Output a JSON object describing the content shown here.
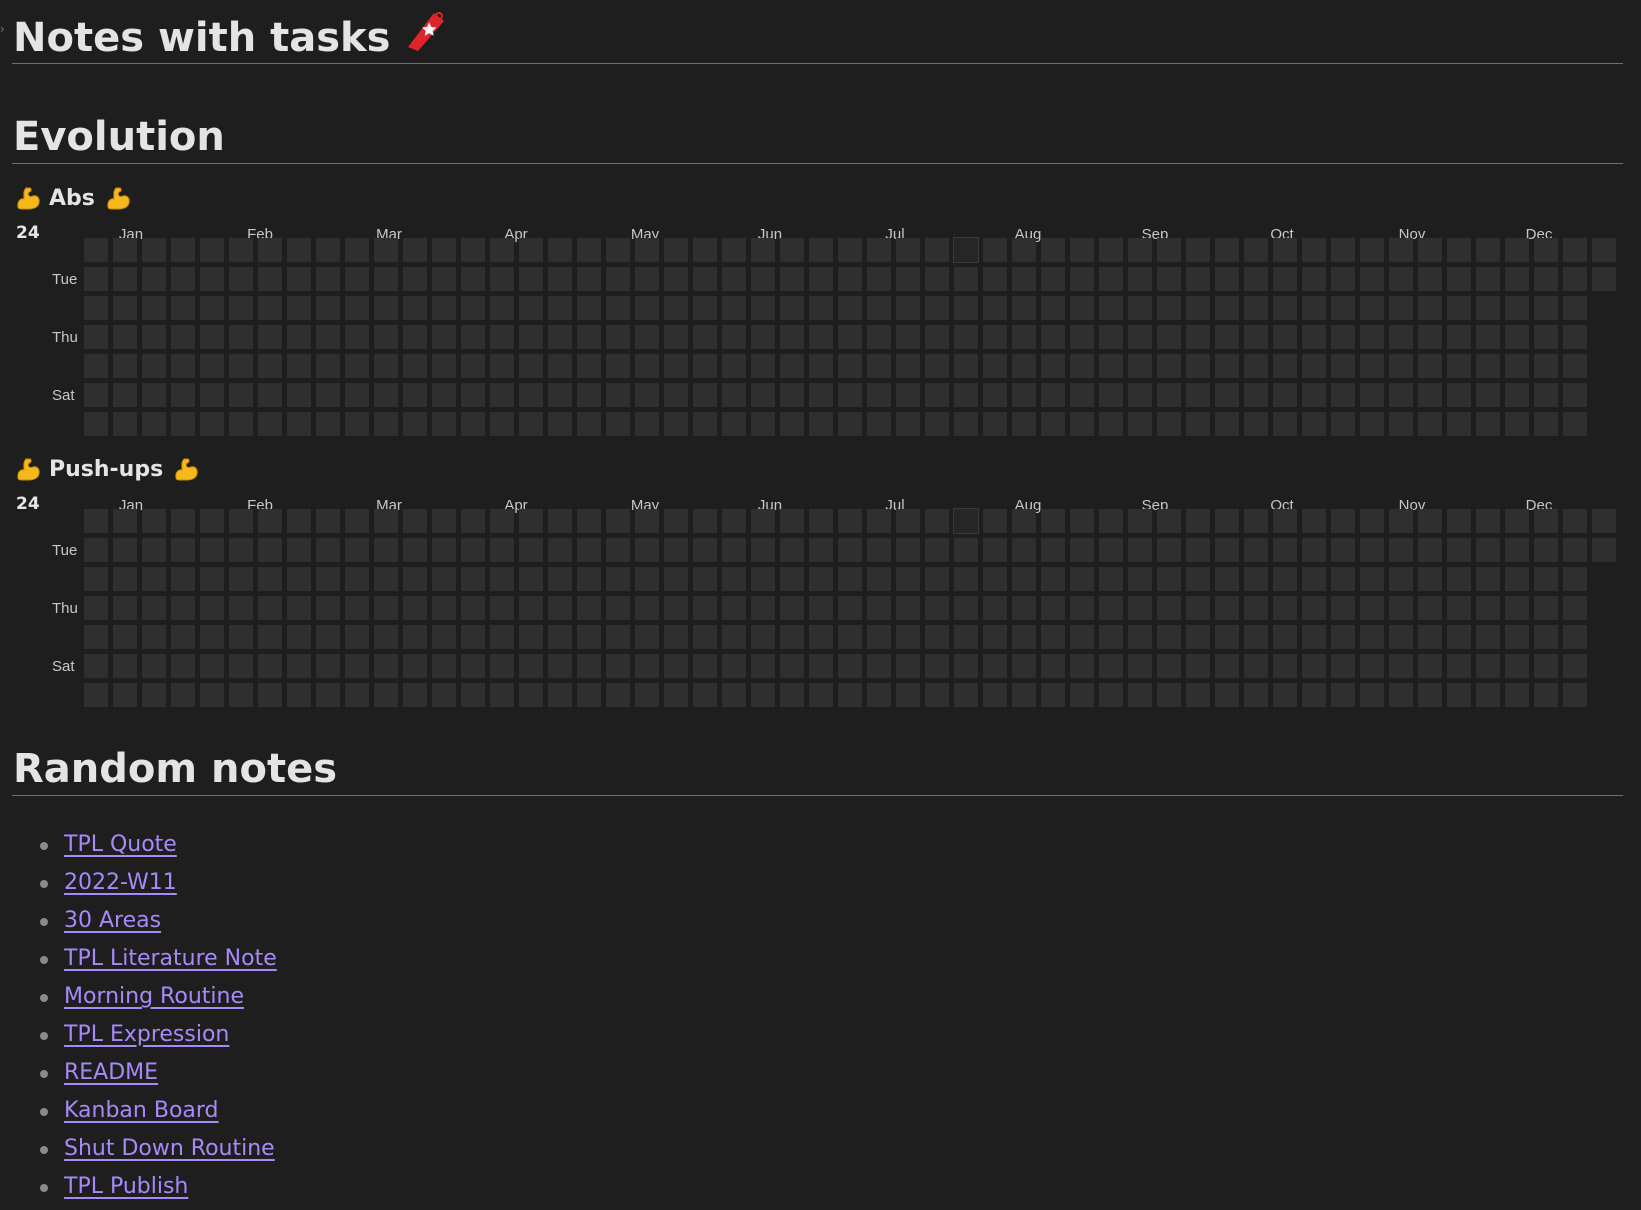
{
  "page": {
    "fold_caret": "›",
    "title": "Notes with tasks",
    "title_icon": "red-tag-icon"
  },
  "evolution": {
    "heading": "Evolution",
    "year": "24",
    "months": [
      "Jan",
      "Feb",
      "Mar",
      "Apr",
      "May",
      "Jun",
      "Jul",
      "Aug",
      "Sep",
      "Oct",
      "Nov",
      "Dec"
    ],
    "day_labels": [
      "Tue",
      "Thu",
      "Sat"
    ],
    "cell_color": "#2f2f2f",
    "trackers": [
      {
        "name": "Abs",
        "icon": "flexed-biceps-icon",
        "completed_days": 0
      },
      {
        "name": "Push-ups",
        "icon": "flexed-biceps-icon",
        "completed_days": 0
      }
    ]
  },
  "random_notes": {
    "heading": "Random notes",
    "link_color": "#a68af9",
    "items": [
      "TPL Quote",
      "2022-W11",
      "30 Areas",
      "TPL Literature Note",
      "Morning Routine",
      "TPL Expression",
      "README",
      "Kanban Board",
      "Shut Down Routine",
      "TPL Publish"
    ]
  }
}
